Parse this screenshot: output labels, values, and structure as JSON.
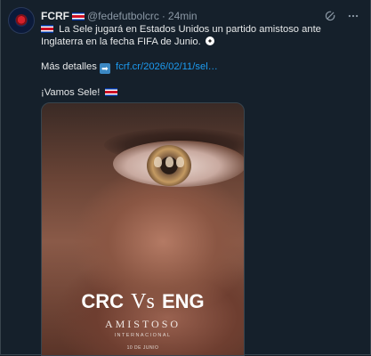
{
  "tweet": {
    "author_name": "FCRF",
    "handle": "@fedefutbolcrc",
    "separator": "·",
    "time": "24min",
    "line1": "La Sele jugará en Estados Unidos un partido amistoso ante Inglaterra en la fecha FIFA de Junio.",
    "details_label": "Más detalles",
    "details_link": "fcrf.cr/2026/02/11/sel…",
    "closing": "¡Vamos Sele!"
  },
  "poster": {
    "team_home": "CRC",
    "vs": "Vs",
    "team_away": "ENG",
    "match_type": "AMISTOSO",
    "category": "INTERNACIONAL",
    "date": "10 DE JUNIO"
  },
  "icons": {
    "avatar": "fcrf-crest",
    "flag": "costa-rica-flag",
    "refresh": "grok-icon",
    "more": "more-icon",
    "arrow": "arrow-right-icon",
    "ball": "soccer-ball-icon"
  },
  "colors": {
    "background": "#15202b",
    "text": "#e7e9ea",
    "secondary_text": "#8b98a5",
    "link": "#1d9bf0"
  }
}
